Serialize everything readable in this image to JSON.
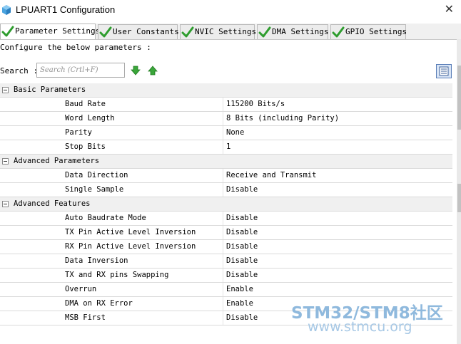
{
  "window": {
    "title": "LPUART1 Configuration",
    "close_glyph": "✕"
  },
  "tabs": [
    {
      "label": "Parameter Settings",
      "active": true
    },
    {
      "label": "User Constants",
      "active": false
    },
    {
      "label": "NVIC Settings",
      "active": false
    },
    {
      "label": "DMA Settings",
      "active": false
    },
    {
      "label": "GPIO Settings",
      "active": false
    }
  ],
  "description": "Configure the below parameters :",
  "search": {
    "label": "Search :",
    "placeholder": "Search (Crtl+F)"
  },
  "groups": [
    {
      "name": "Basic Parameters",
      "params": [
        {
          "name": "Baud Rate",
          "value": "115200 Bits/s"
        },
        {
          "name": "Word Length",
          "value": "8 Bits (including Parity)"
        },
        {
          "name": "Parity",
          "value": "None"
        },
        {
          "name": "Stop Bits",
          "value": "1"
        }
      ]
    },
    {
      "name": "Advanced Parameters",
      "params": [
        {
          "name": "Data Direction",
          "value": "Receive and Transmit"
        },
        {
          "name": "Single Sample",
          "value": "Disable"
        }
      ]
    },
    {
      "name": "Advanced Features",
      "params": [
        {
          "name": "Auto Baudrate Mode",
          "value": "Disable"
        },
        {
          "name": "TX Pin Active Level Inversion",
          "value": "Disable"
        },
        {
          "name": "RX Pin Active Level Inversion",
          "value": "Disable"
        },
        {
          "name": "Data Inversion",
          "value": "Disable"
        },
        {
          "name": "TX and RX pins Swapping",
          "value": "Disable"
        },
        {
          "name": "Overrun",
          "value": "Enable"
        },
        {
          "name": "DMA on RX Error",
          "value": "Enable"
        },
        {
          "name": "MSB First",
          "value": "Disable"
        }
      ]
    }
  ],
  "watermark": {
    "line1": "STM32/STM8社区",
    "line2": "www.stmcu.org"
  },
  "colors": {
    "check_green": "#2e9d2e",
    "arrow_green": "#3aa63a",
    "group_bg": "#f0f0f0",
    "watermark": "#8fb9dd"
  }
}
